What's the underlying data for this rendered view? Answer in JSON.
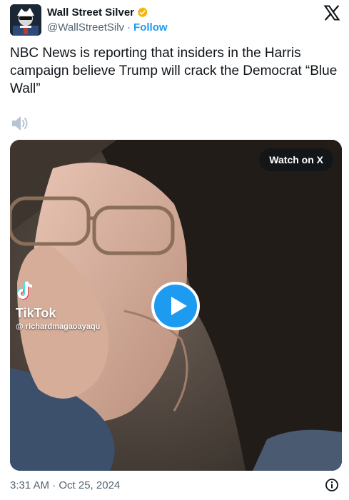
{
  "author": {
    "display_name": "Wall Street Silver",
    "handle": "@WallStreetSilv",
    "separator": "·",
    "follow_label": "Follow",
    "verified_badge": "gold-checkmark",
    "verified_color": "#f4b400"
  },
  "tweet": {
    "text": "NBC News is reporting that insiders in the Harris campaign believe Trump will crack the Democrat “Blue Wall”"
  },
  "media": {
    "watch_label": "Watch on X",
    "tiktok_name": "TikTok",
    "tiktok_user": "@ richardmagaoayaqu",
    "play_color": "#1d9bf0"
  },
  "footer": {
    "timestamp": "3:31 AM · Oct 25, 2024"
  },
  "icons": [
    "avatar",
    "verified-icon",
    "x-logo-icon",
    "speaker-icon",
    "play-icon",
    "tiktok-icon",
    "info-icon"
  ],
  "colors": {
    "text": "#0f1419",
    "secondary": "#536471",
    "accent": "#1d9bf0"
  }
}
